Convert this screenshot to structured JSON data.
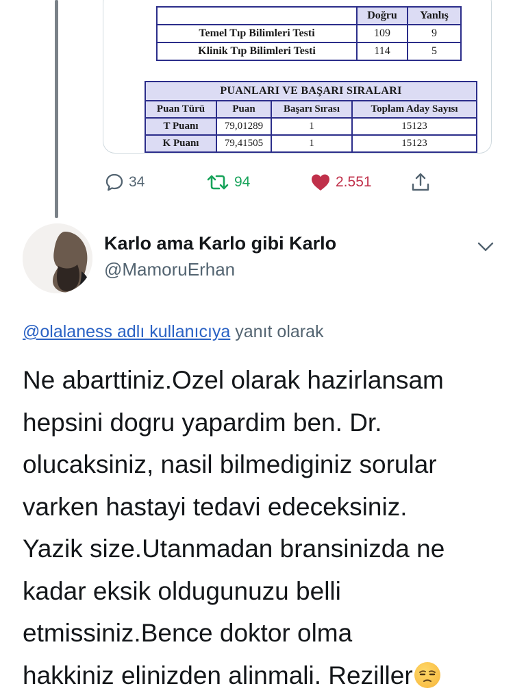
{
  "table_a": {
    "header": [
      "",
      "Doğru",
      "Yanlış"
    ],
    "rows": [
      [
        "Temel Tıp Bilimleri Testi",
        "109",
        "9"
      ],
      [
        "Klinik Tıp Bilimleri Testi",
        "114",
        "5"
      ]
    ]
  },
  "table_b": {
    "title": "PUANLARI VE BAŞARI SIRALARI",
    "header": [
      "Puan Türü",
      "Puan",
      "Başarı Sırası",
      "Toplam Aday Sayısı"
    ],
    "rows": [
      [
        "T Puanı",
        "79,01289",
        "1",
        "15123"
      ],
      [
        "K Puanı",
        "79,41505",
        "1",
        "15123"
      ]
    ]
  },
  "actions": {
    "replies": "34",
    "retweets": "94",
    "likes": "2.551",
    "like_color": "#c0304a",
    "retweet_color": "#17a35a"
  },
  "user": {
    "display_name": "Karlo ama Karlo gibi Karlo",
    "handle": "@MamoruErhan"
  },
  "reply_context": {
    "mention": "@olalaness adlı kullanıcıya",
    "suffix": " yanıt olarak"
  },
  "tweet": {
    "lines": [
      "Ne abarttiniz.Ozel olarak hazirlansam",
      "hepsini dogru yapardim ben. Dr.",
      "olucaksiniz, nasil bilmediginiz sorular",
      "varken hastayi tedavi edeceksiniz.",
      "Yazik size.Utanmadan bransinizda ne",
      "kadar eksik oldugunuzu belli",
      "etmissiniz.Bence doktor olma",
      "hakkiniz elinizden alinmali. Reziller"
    ],
    "emoji": "unamused-face"
  },
  "icons": [
    "reply-icon",
    "retweet-icon",
    "heart-icon",
    "share-icon",
    "chevron-down-icon"
  ],
  "colors": {
    "mention": "#2a62c4",
    "secondary_text": "#536471"
  }
}
